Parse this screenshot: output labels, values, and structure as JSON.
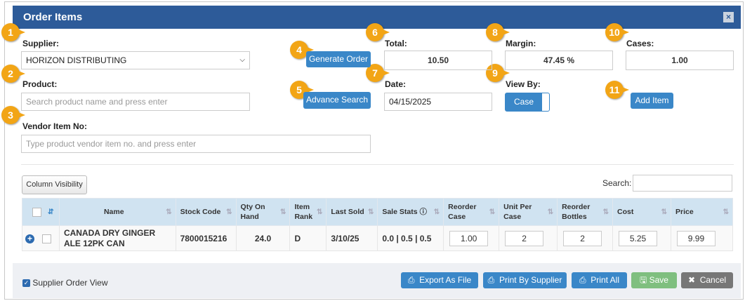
{
  "header": {
    "title": "Order Items",
    "close": "×"
  },
  "callouts": [
    "1",
    "2",
    "3",
    "4",
    "5",
    "6",
    "7",
    "8",
    "9",
    "10",
    "11"
  ],
  "form": {
    "supplier_label": "Supplier:",
    "supplier_value": "HORIZON DISTRIBUTING",
    "product_label": "Product:",
    "product_placeholder": "Search product name and press enter",
    "vendor_label": "Vendor Item No:",
    "vendor_placeholder": "Type product vendor item no. and press enter",
    "generate_order": "Generate Order",
    "advance_search": "Advance Search",
    "total_label": "Total:",
    "total_value": "10.50",
    "date_label": "Date:",
    "date_value": "04/15/2025",
    "margin_label": "Margin:",
    "margin_value": "47.45 %",
    "viewby_label": "View By:",
    "viewby_value": "Case",
    "cases_label": "Cases:",
    "cases_value": "1.00",
    "add_item": "Add Item"
  },
  "table_tools": {
    "column_visibility": "Column Visibility",
    "search_label": "Search:"
  },
  "columns": [
    "Name",
    "Stock Code",
    "Qty On Hand",
    "Item Rank",
    "Last Sold",
    "Sale Stats",
    "Reorder Case",
    "Unit Per Case",
    "Reorder Bottles",
    "Cost",
    "Price"
  ],
  "rows": [
    {
      "name": "CANADA DRY GINGER ALE 12PK CAN",
      "stock_code": "7800015216",
      "qty": "24.0",
      "rank": "D",
      "last_sold": "3/10/25",
      "sale_stats": "0.0 | 0.5 | 0.5",
      "reorder_case": "1.00",
      "unit_per_case": "2",
      "reorder_bottles": "2",
      "cost": "5.25",
      "price": "9.99"
    }
  ],
  "footer": {
    "supplier_order_view": "Supplier Order View",
    "export": "Export As File",
    "print_supplier": "Print By Supplier",
    "print_all": "Print All",
    "save": "Save",
    "cancel": "Cancel"
  },
  "colors": {
    "header": "#2d5b99",
    "primary": "#3a87c8",
    "callout": "#f2a516",
    "save": "#7fbf7f",
    "cancel": "#777777"
  }
}
